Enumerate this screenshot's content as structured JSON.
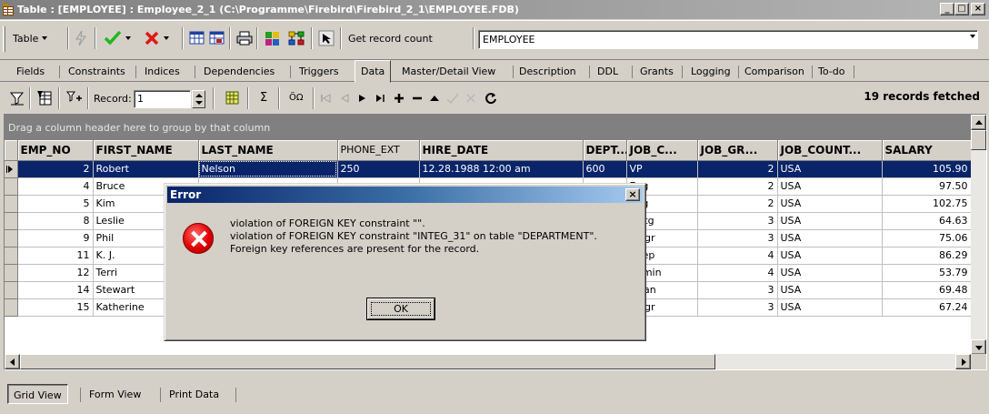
{
  "window": {
    "title": "Table : [EMPLOYEE] : Employee_2_1 (C:\\Programme\\Firebird\\Firebird_2_1\\EMPLOYEE.FDB)",
    "btn_min": "_",
    "btn_max": "□",
    "btn_close": "×"
  },
  "toolbar": {
    "table_menu": "Table",
    "get_record_count": "Get record count",
    "table_name": "EMPLOYEE"
  },
  "tabs": [
    "Fields",
    "Constraints",
    "Indices",
    "Dependencies",
    "Triggers",
    "Data",
    "Master/Detail View",
    "Description",
    "DDL",
    "Grants",
    "Logging",
    "Comparison",
    "To-do"
  ],
  "navigator": {
    "record_label": "Record:",
    "record_value": "1",
    "sum_symbol": "Σ",
    "oo_symbol": "ÖΩ",
    "fetched": "19 records fetched"
  },
  "grid": {
    "group_hint": "Drag a column header here to group by that column",
    "columns": [
      "EMP_NO",
      "FIRST_NAME",
      "LAST_NAME",
      "PHONE_EXT",
      "HIRE_DATE",
      "DEPT...",
      "JOB_C...",
      "JOB_GR...",
      "JOB_COUNT...",
      "SALARY"
    ],
    "rows": [
      [
        "2",
        "Robert",
        "Nelson",
        "250",
        "12.28.1988 12:00 am",
        "600",
        "VP",
        "2",
        "USA",
        "105.90"
      ],
      [
        "4",
        "Bruce",
        "",
        "",
        "",
        "",
        "Eng",
        "2",
        "USA",
        "97.50"
      ],
      [
        "5",
        "Kim",
        "",
        "",
        "",
        "",
        "Eng",
        "2",
        "USA",
        "102.75"
      ],
      [
        "8",
        "Leslie",
        "",
        "",
        "",
        "",
        "Mktg",
        "3",
        "USA",
        "64.63"
      ],
      [
        "9",
        "Phil",
        "",
        "",
        "",
        "",
        "Mngr",
        "3",
        "USA",
        "75.06"
      ],
      [
        "11",
        "K. J.",
        "",
        "",
        "",
        "",
        "SRep",
        "4",
        "USA",
        "86.29"
      ],
      [
        "12",
        "Terri",
        "",
        "",
        "",
        "",
        "Admin",
        "4",
        "USA",
        "53.79"
      ],
      [
        "14",
        "Stewart",
        "",
        "",
        "",
        "",
        "Finan",
        "3",
        "USA",
        "69.48"
      ],
      [
        "15",
        "Katherine",
        "",
        "",
        "",
        "",
        "Mngr",
        "3",
        "USA",
        "67.24"
      ]
    ]
  },
  "viewtabs": [
    "Grid View",
    "Form View",
    "Print Data"
  ],
  "dialog": {
    "title": "Error",
    "close": "×",
    "line1": "violation of FOREIGN KEY constraint \"\".",
    "line2": "violation of FOREIGN KEY constraint \"INTEG_31\" on table \"DEPARTMENT\".",
    "line3": "Foreign key references are present for the record.",
    "ok": "OK"
  },
  "colors": {
    "face": "#d4d0c8",
    "selection": "#0a246a",
    "error_red": "#e00000"
  }
}
